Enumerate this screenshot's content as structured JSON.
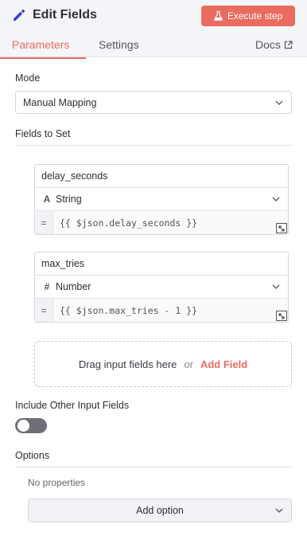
{
  "header": {
    "title": "Edit Fields",
    "execute_label": "Execute step",
    "accent_color": "#ea6b60"
  },
  "tabs": [
    {
      "label": "Parameters",
      "active": true
    },
    {
      "label": "Settings",
      "active": false
    },
    {
      "label": "Docs",
      "active": false
    }
  ],
  "mode": {
    "label": "Mode",
    "value": "Manual Mapping"
  },
  "fields_to_set": {
    "label": "Fields to Set",
    "fields": [
      {
        "name": "delay_seconds",
        "type": "String",
        "type_icon": "A",
        "value": "{{ $json.delay_seconds }}"
      },
      {
        "name": "max_tries",
        "type": "Number",
        "type_icon": "#",
        "value": "{{ $json.max_tries - 1 }}"
      }
    ],
    "eq_symbol": "=",
    "dropzone_text": "Drag input fields here",
    "dropzone_or": "or",
    "add_field_label": "Add Field"
  },
  "include_other": {
    "label": "Include Other Input Fields",
    "enabled": false
  },
  "options": {
    "label": "Options",
    "empty_text": "No properties",
    "add_option_label": "Add option"
  }
}
